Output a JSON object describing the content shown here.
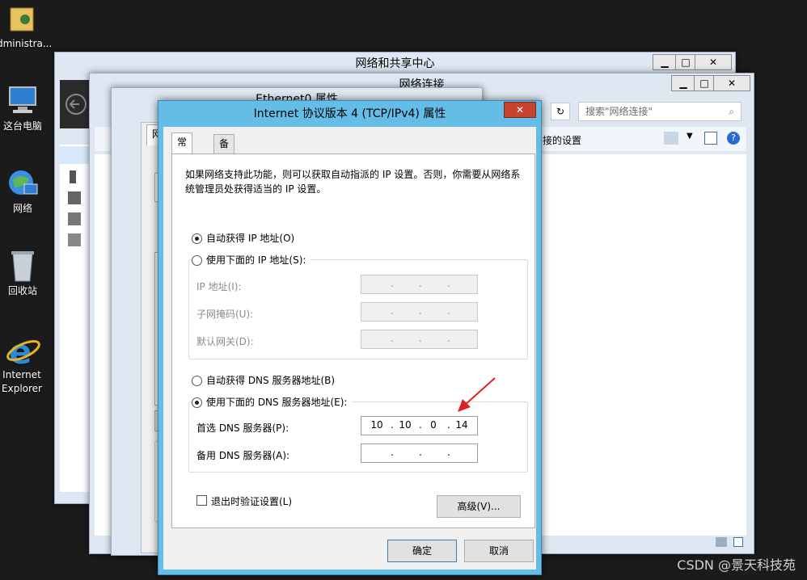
{
  "desktop": {
    "icons": [
      {
        "label": "dministra..."
      },
      {
        "label": "这台电脑"
      },
      {
        "label": "网络"
      },
      {
        "label": "回收站"
      },
      {
        "label": "Internet"
      },
      {
        "label": "Explorer"
      }
    ]
  },
  "window_network_center": {
    "title": "网络和共享中心",
    "minimize": "▁",
    "maximize": "□",
    "close": "✕"
  },
  "window_network_connections": {
    "title": "网络连接",
    "minimize": "▁",
    "maximize": "□",
    "close": "✕",
    "search_placeholder": "搜索\"网络连接\"",
    "toolbar_text": "接的设置"
  },
  "window_ethernet": {
    "title": "Ethernet0 属性",
    "tab_partial": "网"
  },
  "dialog": {
    "title": "Internet 协议版本 4 (TCP/IPv4) 属性",
    "close": "✕",
    "tabs": [
      "常规",
      "备用配置"
    ],
    "description": "如果网络支持此功能，则可以获取自动指派的 IP 设置。否则，你需要从网络系统管理员处获得适当的 IP 设置。",
    "ip_auto": "自动获得 IP 地址(O)",
    "ip_manual": "使用下面的 IP 地址(S):",
    "ip_address_label": "IP 地址(I):",
    "subnet_label": "子网掩码(U):",
    "gateway_label": "默认网关(D):",
    "dns_auto": "自动获得 DNS 服务器地址(B)",
    "dns_manual": "使用下面的 DNS 服务器地址(E):",
    "dns_preferred_label": "首选 DNS 服务器(P):",
    "dns_alternate_label": "备用 DNS 服务器(A):",
    "dns_preferred": [
      "10",
      "10",
      "0",
      "14"
    ],
    "validate_label": "退出时验证设置(L)",
    "advanced_button": "高级(V)...",
    "ok_button": "确定",
    "cancel_button": "取消",
    "dot": "."
  },
  "watermark": "CSDN @景天科技苑",
  "colors": {
    "dialog_frame": "#63bde6",
    "close_red": "#c7432f",
    "annotation_arrow": "#e02020"
  }
}
